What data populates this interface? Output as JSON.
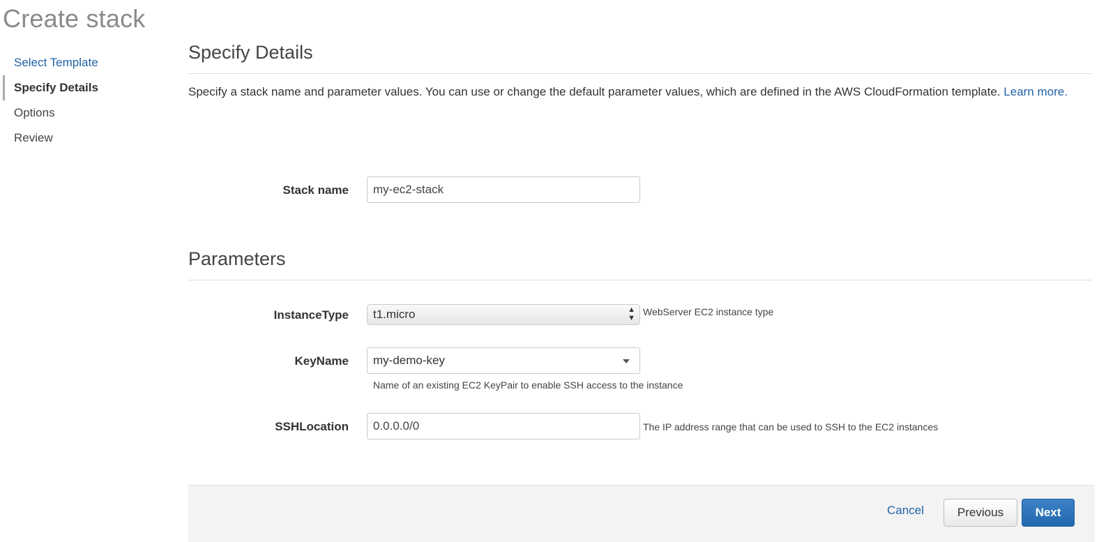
{
  "page": {
    "title": "Create stack"
  },
  "sidebar": {
    "steps": [
      {
        "label": "Select Template",
        "state": "link"
      },
      {
        "label": "Specify Details",
        "state": "active"
      },
      {
        "label": "Options",
        "state": "pending"
      },
      {
        "label": "Review",
        "state": "pending"
      }
    ]
  },
  "details": {
    "heading": "Specify Details",
    "description": "Specify a stack name and parameter values. You can use or change the default parameter values, which are defined in the AWS CloudFormation template.",
    "learn_more": "Learn more.",
    "stack_name_label": "Stack name",
    "stack_name_value": "my-ec2-stack"
  },
  "parameters": {
    "heading": "Parameters",
    "instance_type": {
      "label": "InstanceType",
      "value": "t1.micro",
      "help": "WebServer EC2 instance type"
    },
    "key_name": {
      "label": "KeyName",
      "value": "my-demo-key",
      "help": "Name of an existing EC2 KeyPair to enable SSH access to the instance"
    },
    "ssh_location": {
      "label": "SSHLocation",
      "value": "0.0.0.0/0",
      "help": "The IP address range that can be used to SSH to the EC2 instances"
    }
  },
  "footer": {
    "cancel_label": "Cancel",
    "previous_label": "Previous",
    "next_label": "Next"
  },
  "colors": {
    "link": "#1f63a8",
    "primary_button": "#2268ae",
    "title_gray": "#8a8a8a",
    "footer_bg": "#f3f3f3"
  }
}
